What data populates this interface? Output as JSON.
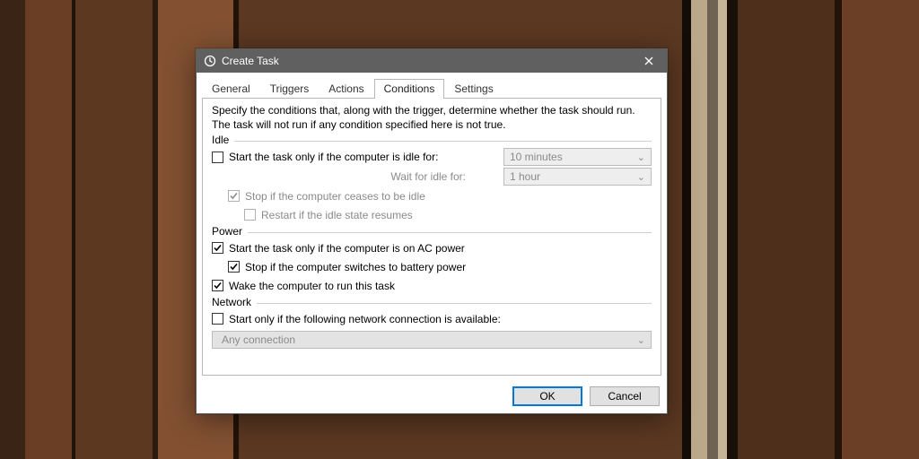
{
  "window": {
    "title": "Create Task"
  },
  "tabs": {
    "general": "General",
    "triggers": "Triggers",
    "actions": "Actions",
    "conditions": "Conditions",
    "settings": "Settings",
    "active": "conditions"
  },
  "conditions": {
    "description": "Specify the conditions that, along with the trigger, determine whether the task should run.  The task will not run  if any condition specified here is not true.",
    "idle": {
      "label": "Idle",
      "start_only_if_idle": "Start the task only if the computer is idle for:",
      "start_only_if_idle_checked": false,
      "idle_duration": "10 minutes",
      "wait_for_idle_label": "Wait for idle for:",
      "wait_for_idle_value": "1 hour",
      "stop_if_ceases": "Stop if the computer ceases to be idle",
      "stop_if_ceases_checked": true,
      "restart_if_resumes": "Restart if the idle state resumes",
      "restart_if_resumes_checked": false
    },
    "power": {
      "label": "Power",
      "start_only_on_ac": "Start the task only if the computer is on AC power",
      "start_only_on_ac_checked": true,
      "stop_on_battery": "Stop if the computer switches to battery power",
      "stop_on_battery_checked": true,
      "wake_to_run": "Wake the computer to run this task",
      "wake_to_run_checked": true
    },
    "network": {
      "label": "Network",
      "start_only_if_network": "Start only if the following network connection is available:",
      "start_only_if_network_checked": false,
      "connection": "Any connection"
    }
  },
  "buttons": {
    "ok": "OK",
    "cancel": "Cancel"
  }
}
